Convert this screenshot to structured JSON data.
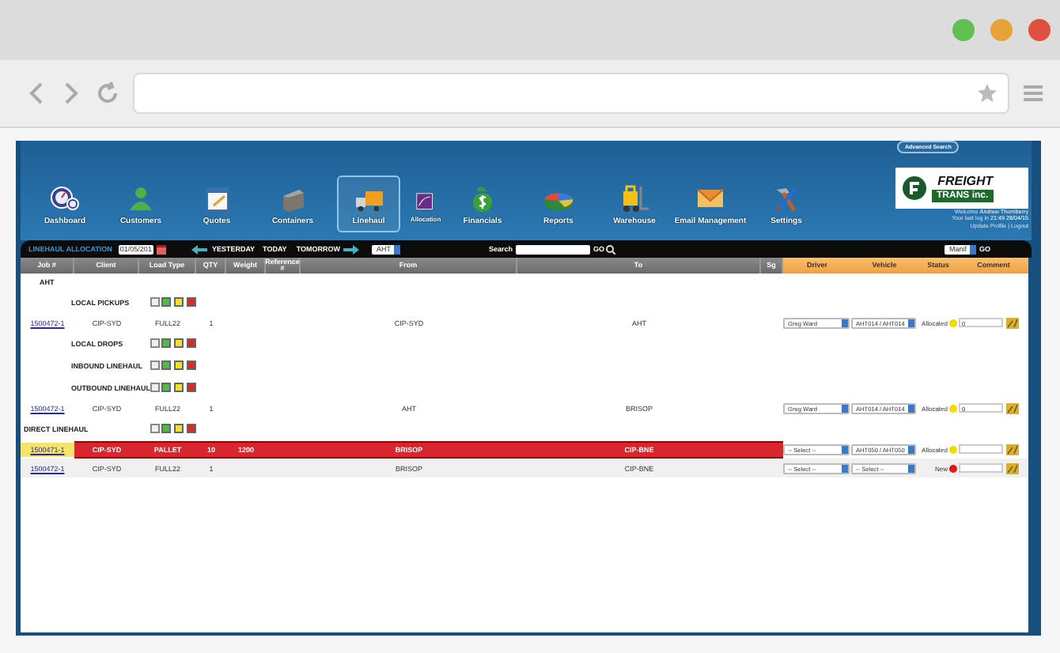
{
  "nav": [
    {
      "label": "Dashboard",
      "kind": "main",
      "selected": false
    },
    {
      "label": "Customers",
      "kind": "main",
      "selected": false
    },
    {
      "label": "Quotes",
      "kind": "main",
      "selected": false
    },
    {
      "label": "Containers",
      "kind": "main",
      "selected": false
    },
    {
      "label": "Linehaul",
      "kind": "main",
      "selected": true
    },
    {
      "label": "Allocation",
      "kind": "sub",
      "selected": false
    },
    {
      "label": "Financials",
      "kind": "main",
      "selected": false
    },
    {
      "label": "Reports",
      "kind": "main",
      "selected": false
    },
    {
      "label": "Warehouse",
      "kind": "main",
      "selected": false
    },
    {
      "label": "Email Management",
      "kind": "main",
      "selected": false
    },
    {
      "label": "Settings",
      "kind": "main",
      "selected": false
    }
  ],
  "advanced_search": "Advanced Search",
  "logo": {
    "line1": "FREIGHT",
    "line2": "TRANS inc."
  },
  "user": {
    "welcome": "Welcome",
    "name": "Andrew Thornberry",
    "last_login_label": "Your last log in",
    "last_login": "21:49 28/04/15",
    "links": [
      "Update Profile",
      "Logout"
    ],
    "separator": "|"
  },
  "toolbar": {
    "title": "LINEHAUL ALLOCATION",
    "date": "01/05/201",
    "yesterday": "YESTERDAY",
    "today": "TODAY",
    "tomorrow": "TOMORROW",
    "depot": "AHT",
    "search_label": "Search",
    "search_button": "GO",
    "manifest": "Manif",
    "manifest_button": "GO"
  },
  "table": {
    "columns": [
      {
        "label": "Job #",
        "kind": "plain"
      },
      {
        "label": "Client",
        "kind": "plain"
      },
      {
        "label": "Load Type",
        "kind": "plain"
      },
      {
        "label": "QTY",
        "kind": "plain"
      },
      {
        "label": "Weight",
        "kind": "plain"
      },
      {
        "label": "Reference #",
        "kind": "plain"
      },
      {
        "label": "From",
        "kind": "plain"
      },
      {
        "label": "To",
        "kind": "plain"
      },
      {
        "label": "Sg",
        "kind": "plain"
      },
      {
        "label": "Driver",
        "kind": "assign"
      },
      {
        "label": "Vehicle",
        "kind": "assign"
      },
      {
        "label": "Status",
        "kind": "assign"
      },
      {
        "label": "Comment",
        "kind": "assign"
      }
    ],
    "sections": [
      {
        "label": "AHT",
        "kind": "depot",
        "children": [
          {
            "label": "LOCAL PICKUPS",
            "checked": false,
            "jobs": [
              {
                "job": "1500472-1",
                "client": "CIP-SYD",
                "load_type": "FULL22",
                "qty": "1",
                "from": "CIP-SYD",
                "to": "AHT",
                "driver": "Greg Ward",
                "vehicle": "AHT014 / AHT014",
                "status": "Allocated",
                "color": "#f2dc00",
                "comment": "0",
                "highlighted": false
              }
            ]
          },
          {
            "label": "LOCAL DROPS",
            "checked": false
          },
          {
            "label": "INBOUND LINEHAUL",
            "checked": false
          },
          {
            "label": "OUTBOUND LINEHAUL",
            "checked": false,
            "jobs": [
              {
                "job": "1500472-1",
                "client": "CIP-SYD",
                "load_type": "FULL22",
                "qty": "1",
                "from": "AHT",
                "to": "BRISOP",
                "driver": "Greg Ward",
                "vehicle": "AHT014 / AHT014",
                "status": "Allocated",
                "color": "#f2dc00",
                "comment": "0",
                "highlighted": false
              }
            ]
          }
        ]
      },
      {
        "label": "DIRECT LINEHAUL",
        "kind": "group",
        "checked": false,
        "jobs": [
          {
            "job": "1500471-1",
            "client": "CIP-SYD",
            "load_type": "PALLET",
            "qty": "10",
            "weight": "1200",
            "from": "BRISOP",
            "to": "CIP-BNE",
            "driver": "-- Select --",
            "vehicle": "AHT050 / AHT050",
            "status": "Allocated",
            "color": "#f2dc00",
            "highlighted": true
          },
          {
            "job": "1500472-1",
            "client": "CIP-SYD",
            "load_type": "FULL22",
            "qty": "1",
            "from": "BRISOP",
            "to": "CIP-BNE",
            "driver": "-- Select --",
            "vehicle": "-- Select --",
            "status": "New",
            "color": "#e01818",
            "highlighted": false
          }
        ]
      }
    ]
  }
}
